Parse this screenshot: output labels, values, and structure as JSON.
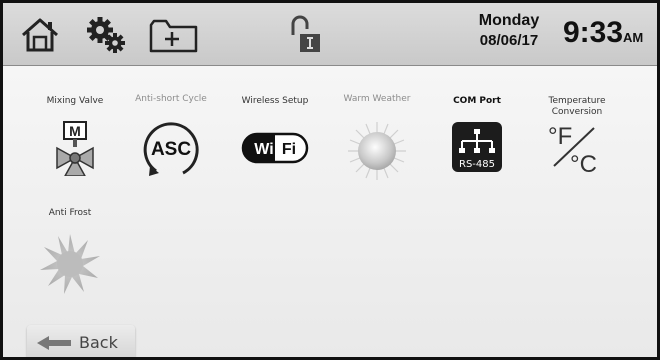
{
  "header": {
    "day": "Monday",
    "date": "08/06/17",
    "time": "9:33",
    "ampm": "AM",
    "icons": [
      "home-icon",
      "settings-gears-icon",
      "add-folder-icon",
      "installer-lock-icon"
    ]
  },
  "tiles": [
    {
      "label": "Mixing Valve",
      "icon": "mixing-valve-icon",
      "glyph": "M"
    },
    {
      "label": "Anti-short Cycle",
      "icon": "anti-short-cycle-icon",
      "glyph": "ASC"
    },
    {
      "label": "Wireless Setup",
      "icon": "wifi-icon",
      "glyph_a": "Wi",
      "glyph_b": "Fi"
    },
    {
      "label": "Warm Weather",
      "icon": "sun-icon"
    },
    {
      "label": "COM Port",
      "icon": "rs485-port-icon",
      "glyph": "RS-485"
    },
    {
      "label": "Temperature Conversion",
      "icon": "temperature-conversion-icon",
      "glyph_a": "°F",
      "glyph_b": "°C"
    },
    {
      "label": "Anti Frost",
      "icon": "frost-icon"
    }
  ],
  "footer": {
    "back_label": "Back"
  },
  "colors": {
    "header_bg": "#d2d2d2",
    "content_bg": "#eeeeee",
    "icon_dark": "#1b1b1b",
    "disabled_gray": "#b4b4b4"
  }
}
